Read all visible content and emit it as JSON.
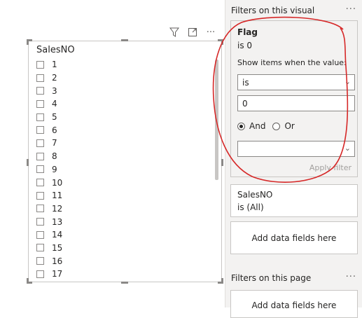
{
  "visual": {
    "header_icons": [
      "filter-icon",
      "focus-mode-icon",
      "more-options-icon"
    ],
    "more_label": "···",
    "slicer": {
      "title": "SalesNO",
      "items": [
        {
          "label": "1"
        },
        {
          "label": "2"
        },
        {
          "label": "3"
        },
        {
          "label": "4"
        },
        {
          "label": "5"
        },
        {
          "label": "6"
        },
        {
          "label": "7"
        },
        {
          "label": "8"
        },
        {
          "label": "9"
        },
        {
          "label": "10"
        },
        {
          "label": "11"
        },
        {
          "label": "12"
        },
        {
          "label": "13"
        },
        {
          "label": "14"
        },
        {
          "label": "15"
        },
        {
          "label": "16"
        },
        {
          "label": "17"
        }
      ]
    }
  },
  "filters_pane": {
    "visual_section_title": "Filters on this visual",
    "more_label": "···",
    "flag_filter": {
      "title": "Flag",
      "summary": "is 0",
      "show_items_label": "Show items when the value:",
      "operator1": "is",
      "value1": "0",
      "and_label": "And",
      "or_label": "Or",
      "selected_logic": "And",
      "operator2": "",
      "apply_label": "Apply filter"
    },
    "salesno_filter": {
      "title": "SalesNO",
      "summary": "is (All)"
    },
    "add_fields_label": "Add data fields here",
    "page_section_title": "Filters on this page",
    "page_add_fields_label": "Add data fields here"
  },
  "colors": {
    "annotation": "#d62828",
    "pane_bg": "#f3f2f1",
    "border": "#c8c6c4"
  }
}
